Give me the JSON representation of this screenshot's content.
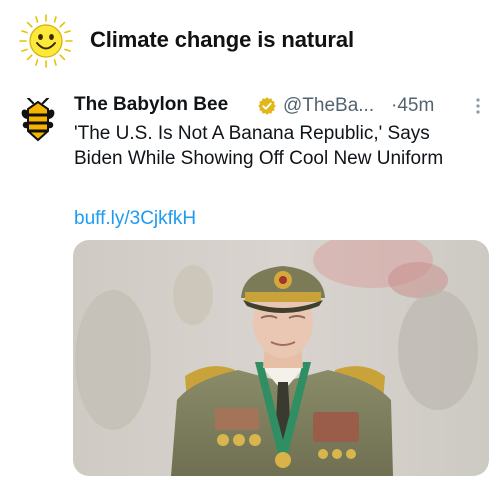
{
  "header": {
    "title": "Climate change is natural",
    "icon": "smiling-sun-icon"
  },
  "tweet": {
    "author_name": "The Babylon Bee",
    "verified_icon": "gold-verified-badge-icon",
    "handle": "@TheBa...",
    "time": "·45m",
    "text": "'The U.S. Is Not A Banana Republic,' Says Biden While Showing Off Cool New Uniform",
    "link": "buff.ly/3CjkfkH",
    "media_icon": "photo-of-man-in-military-uniform",
    "colors": {
      "link": "#1d9bf0",
      "secondary_text": "#536471",
      "verified_gold": "#e2b719"
    }
  }
}
